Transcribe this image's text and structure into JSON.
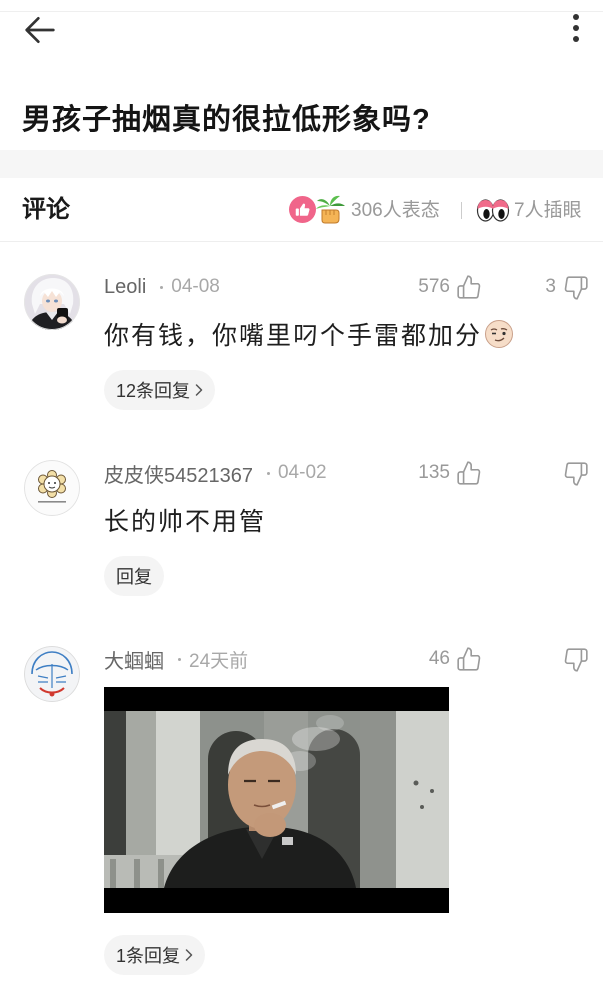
{
  "colors": {
    "text_primary": "#1a1a1a",
    "text_secondary": "#999999",
    "username": "#666666",
    "pill_background": "#f4f4f4",
    "reaction_pink": "#f0658a",
    "divider": "#eeeeee"
  },
  "header": {
    "back_icon": "back-arrow-icon",
    "menu_icon": "more-vertical-icon"
  },
  "post": {
    "title": "男孩子抽烟真的很拉低形象吗?"
  },
  "comments_section": {
    "title": "评论",
    "reaction_icons": [
      "pink-thumbs-up-icon",
      "green-hand-icon"
    ],
    "reactions_label": "306人表态",
    "watch_icon": "eyes-icon",
    "watch_label": "7人插眼"
  },
  "comments": [
    {
      "username": "Leoli",
      "date": "04-08",
      "likes": "576",
      "dislikes": "3",
      "text": "你有钱，你嘴里叼个手雷都加分",
      "text_emoji": "smirk-face-emoji-icon",
      "reply_label": "12条回复"
    },
    {
      "username": "皮皮侠54521367",
      "date": "04-02",
      "likes": "135",
      "text": "长的帅不用管",
      "reply_label": "回复"
    },
    {
      "username": "大蝈蝈",
      "date": "24天前",
      "likes": "46",
      "reply_label": "1条回复"
    }
  ]
}
